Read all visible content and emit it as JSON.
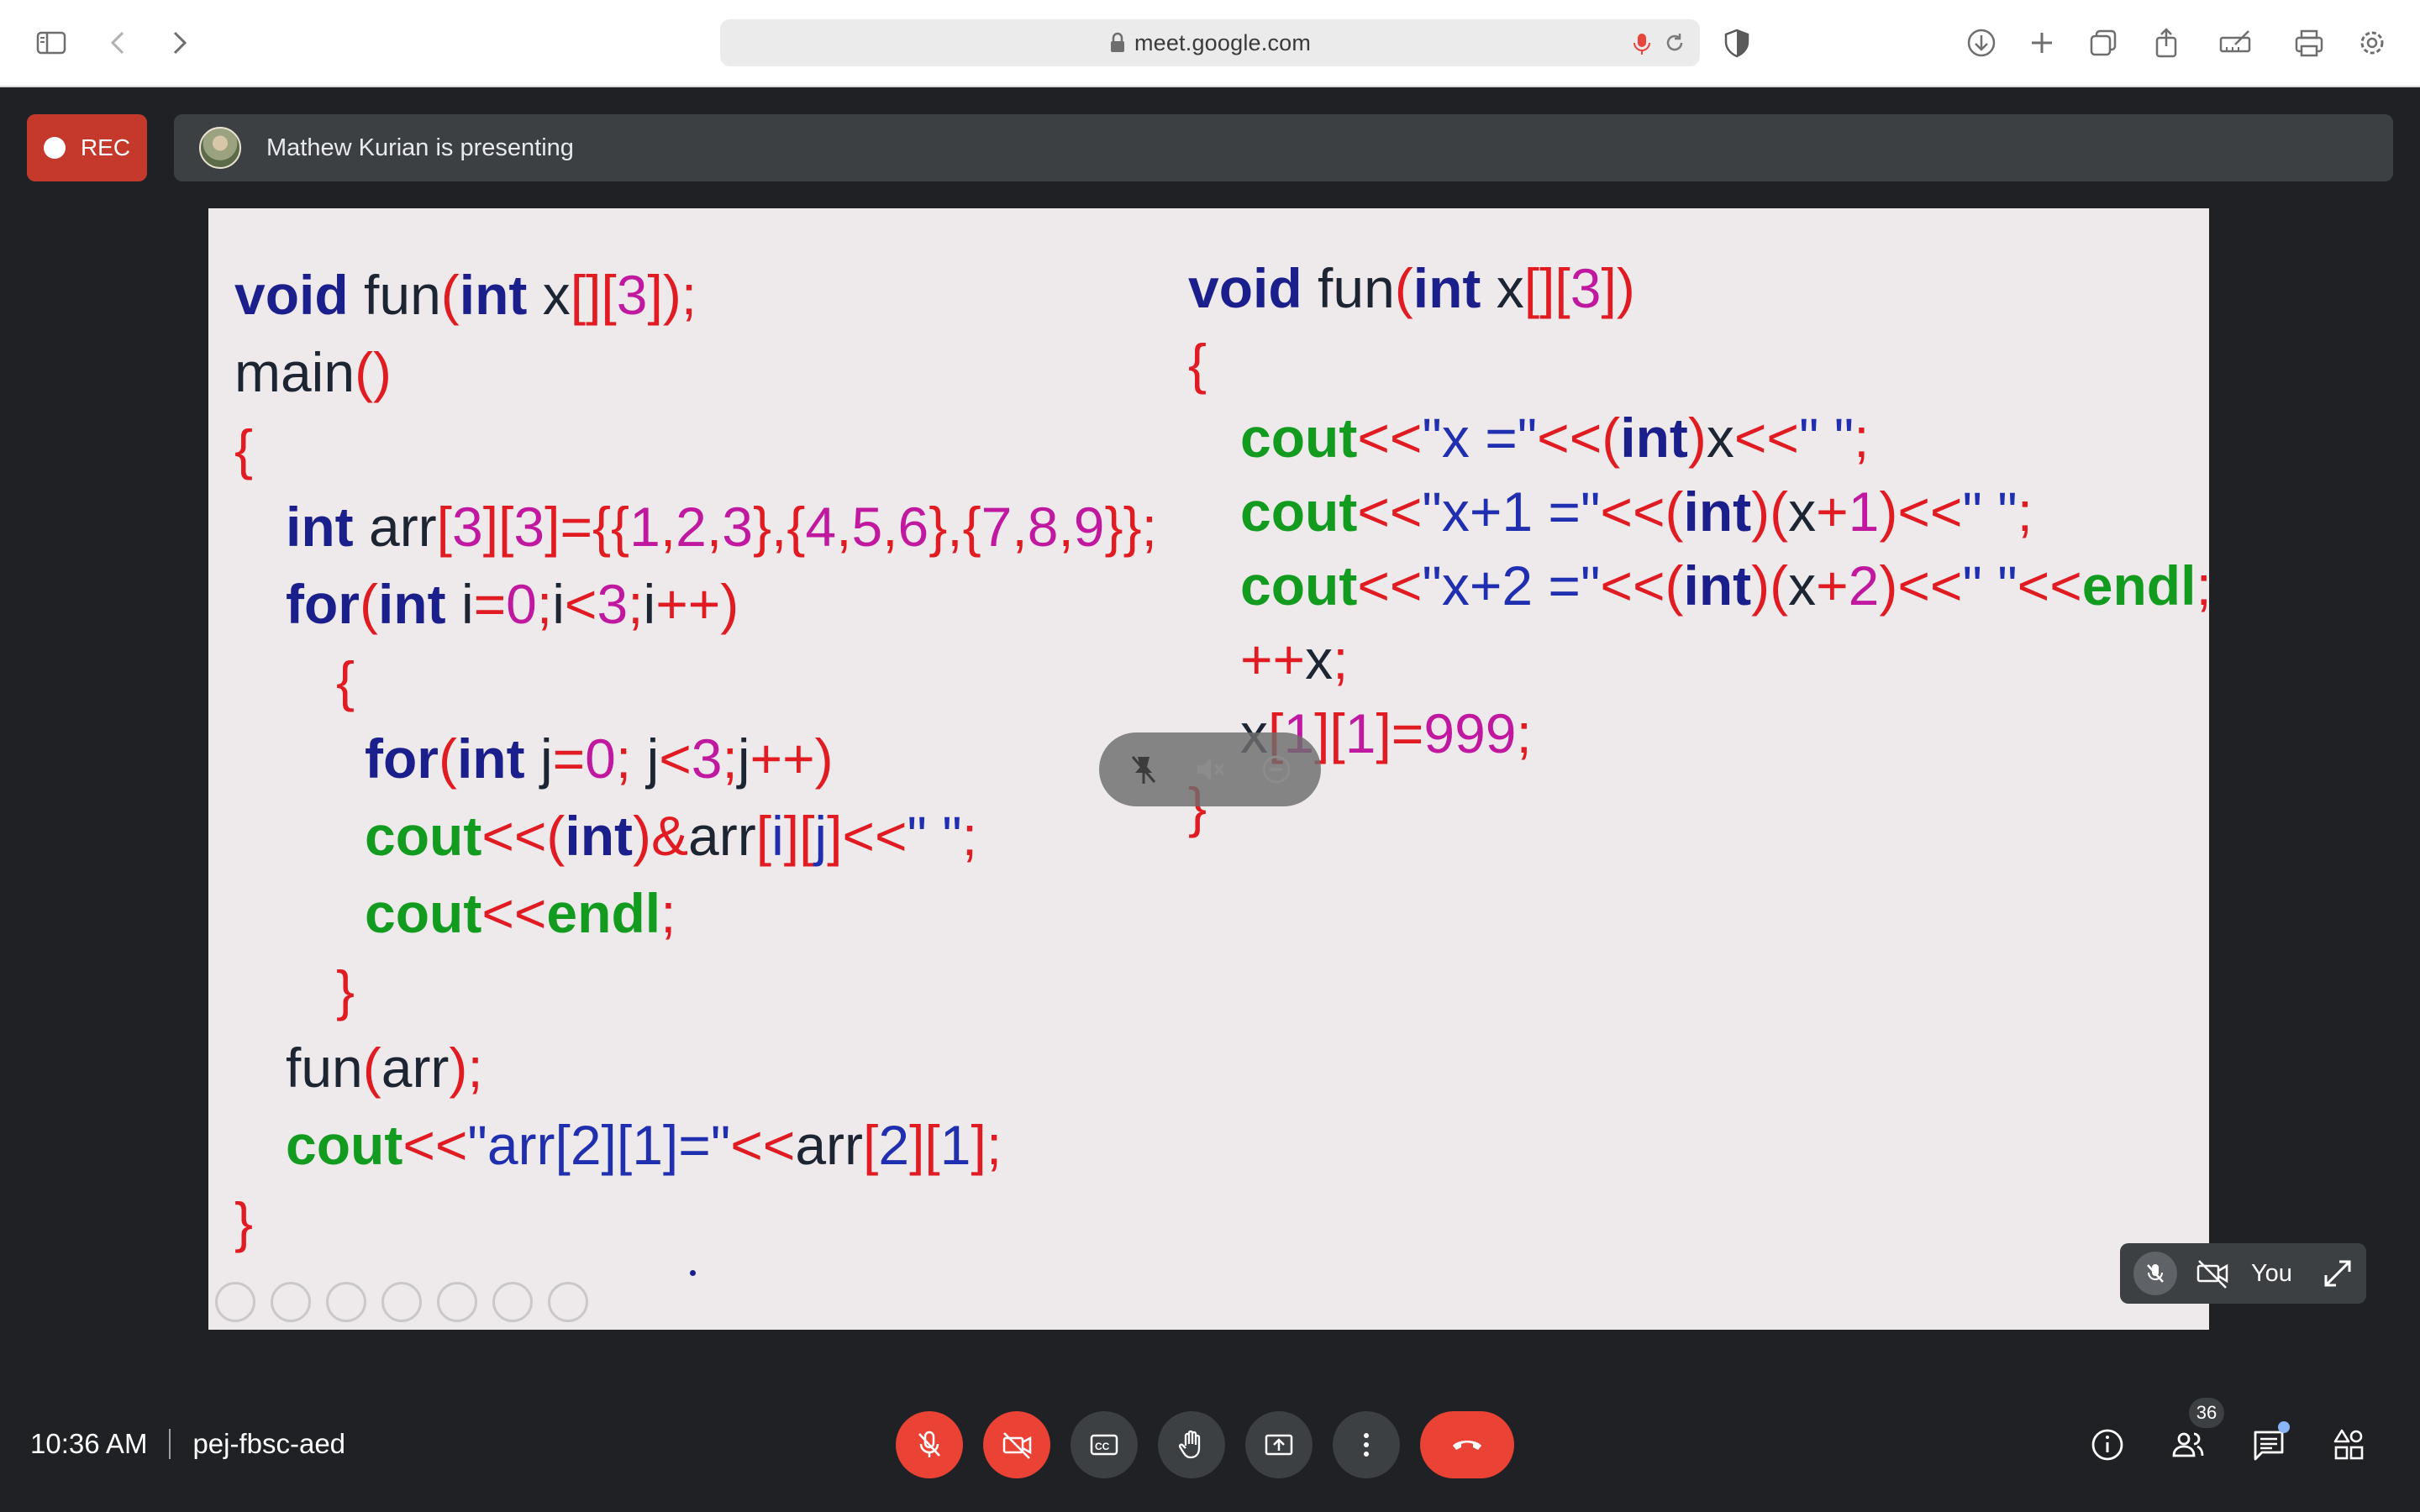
{
  "browser": {
    "url": "meet.google.com",
    "icons": [
      "sidebar-icon",
      "back-icon",
      "forward-icon",
      "lock-icon",
      "mic-icon",
      "reload-icon",
      "shield-icon",
      "download-icon",
      "plus-icon",
      "tabs-icon",
      "share-icon",
      "screenshot-icon",
      "print-icon",
      "settings-icon"
    ]
  },
  "meet": {
    "rec_label": "REC",
    "presenting_text": "Mathew Kurian is presenting",
    "self_label": "You",
    "time": "10:36 AM",
    "meeting_code": "pej-fbsc-aed",
    "participants_count": "36"
  },
  "slide": {
    "left_code": [
      "void fun(int x[][3]);",
      "main()",
      "{",
      "   int arr[3][3]={{1,2,3},{4,5,6},{7,8,9}};",
      "   for(int i=0;i<3;i++)",
      "      {",
      "        for(int j=0; j<3;j++)",
      "        cout<<(int)&arr[i][j]<<\" \";",
      "        cout<<endl;",
      "      }",
      "   fun(arr);",
      "   cout<<\"arr[2][1]=\"<<arr[2][1];",
      "}"
    ],
    "right_code": [
      "void fun(int x[][3])",
      "{",
      "   cout<<\"x =\"<<(int)x<<\" \";",
      "   cout<<\"x+1 =\"<<(int)(x+1)<<\" \";",
      "   cout<<\"x+2 =\"<<(int)(x+2)<<\" \"<<endl;",
      "   ++x;",
      "   x[1][1]=999;",
      "}"
    ]
  },
  "colors": {
    "rec_red": "#c5392c",
    "end_call_red": "#ea4335",
    "keyword_blue": "#1a1f8c",
    "cout_green": "#129b1e",
    "operator_red": "#e11b22",
    "number_magenta": "#c0189e"
  }
}
